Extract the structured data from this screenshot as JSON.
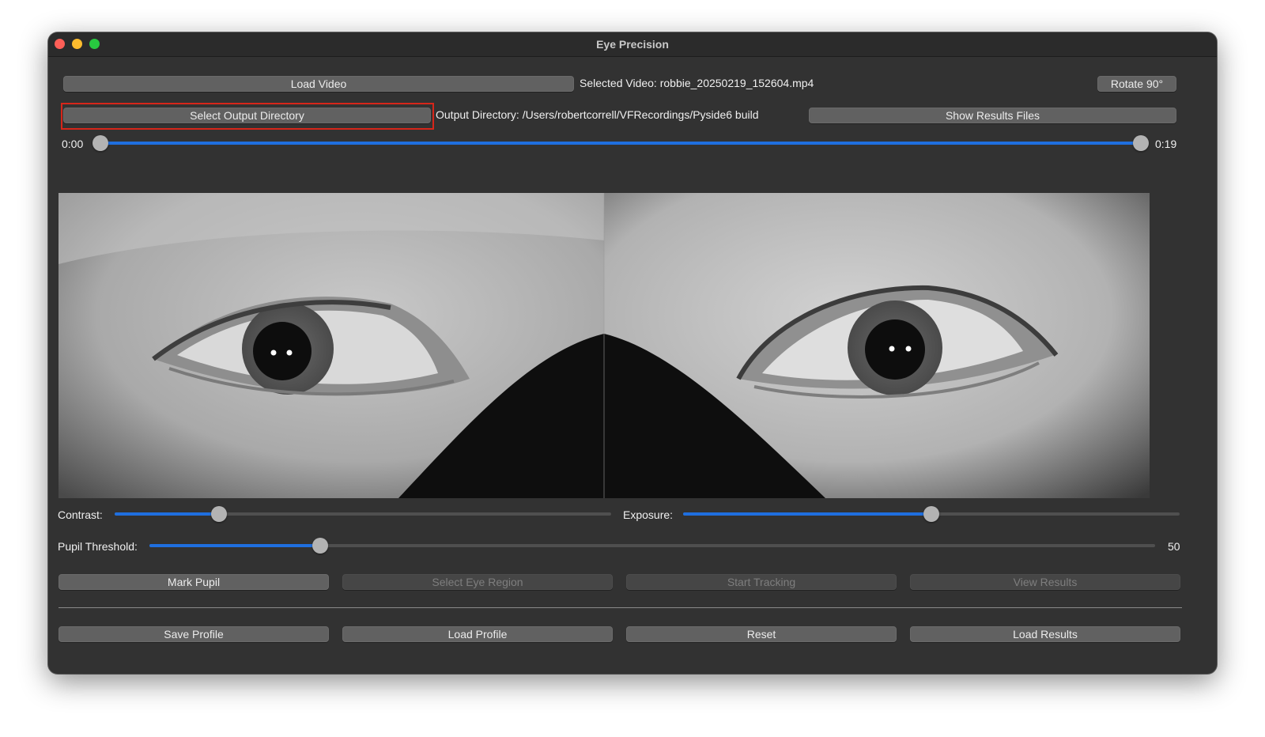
{
  "window": {
    "title": "Eye Precision"
  },
  "top_row": {
    "load_video_label": "Load Video",
    "selected_video_text": "Selected Video: robbie_20250219_152604.mp4",
    "rotate_label": "Rotate 90°"
  },
  "second_row": {
    "select_output_label": "Select Output Directory",
    "output_directory_text": "Output Directory: /Users/robertcorrell/VFRecordings/Pyside6 build",
    "show_results_label": "Show Results Files"
  },
  "timeline": {
    "start_time": "0:00",
    "end_time": "0:19",
    "position_fraction": 1.0
  },
  "controls": {
    "contrast_label": "Contrast:",
    "contrast_fraction": 0.21,
    "exposure_label": "Exposure:",
    "exposure_fraction": 0.5,
    "pupil_threshold_label": "Pupil Threshold:",
    "pupil_threshold_fraction": 0.17,
    "pupil_threshold_value": "50"
  },
  "actions": {
    "mark_pupil_label": "Mark Pupil",
    "select_eye_region_label": "Select Eye Region",
    "start_tracking_label": "Start Tracking",
    "view_results_label": "View Results"
  },
  "bottom": {
    "save_profile_label": "Save Profile",
    "load_profile_label": "Load Profile",
    "reset_label": "Reset",
    "load_results_label": "Load Results"
  },
  "colors": {
    "slider_fill": "#1f6fdf",
    "highlight_border": "#d6261a",
    "window_bg": "#323232"
  }
}
